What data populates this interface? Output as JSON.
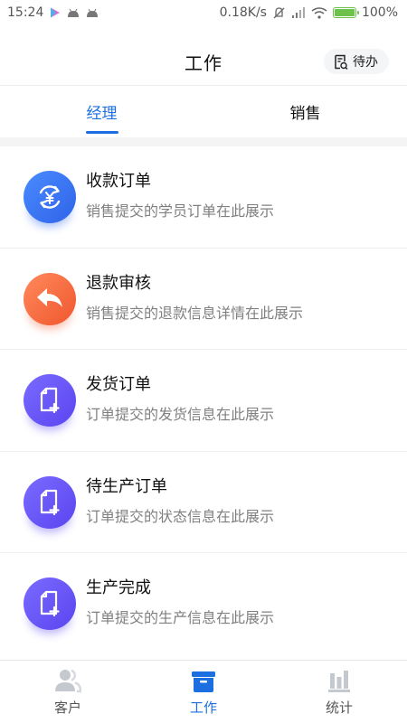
{
  "status_bar": {
    "time": "15:24",
    "network_speed": "0.18K/s",
    "battery": "100%"
  },
  "header": {
    "title": "工作",
    "todo_label": "待办"
  },
  "tabs": [
    {
      "label": "经理",
      "active": true
    },
    {
      "label": "销售",
      "active": false
    }
  ],
  "menu": [
    {
      "title": "收款订单",
      "desc": "销售提交的学员订单在此展示",
      "icon": "payment-exchange-icon",
      "color": "blue"
    },
    {
      "title": "退款审核",
      "desc": "销售提交的退款信息详情在此展示",
      "icon": "return-arrow-icon",
      "color": "orange"
    },
    {
      "title": "发货订单",
      "desc": "订单提交的发货信息在此展示",
      "icon": "document-add-icon",
      "color": "purple"
    },
    {
      "title": "待生产订单",
      "desc": "订单提交的状态信息在此展示",
      "icon": "document-add-icon",
      "color": "purple"
    },
    {
      "title": "生产完成",
      "desc": "订单提交的生产信息在此展示",
      "icon": "document-add-icon",
      "color": "purple"
    }
  ],
  "bottom_nav": [
    {
      "label": "客户",
      "icon": "users-icon",
      "active": false
    },
    {
      "label": "工作",
      "icon": "briefcase-icon",
      "active": true
    },
    {
      "label": "统计",
      "icon": "bar-chart-icon",
      "active": false
    }
  ],
  "colors": {
    "accent": "#1b6fe0",
    "blue_icon": "#3b6ff0",
    "orange_icon": "#f36a3f",
    "purple_icon": "#6452f3"
  }
}
